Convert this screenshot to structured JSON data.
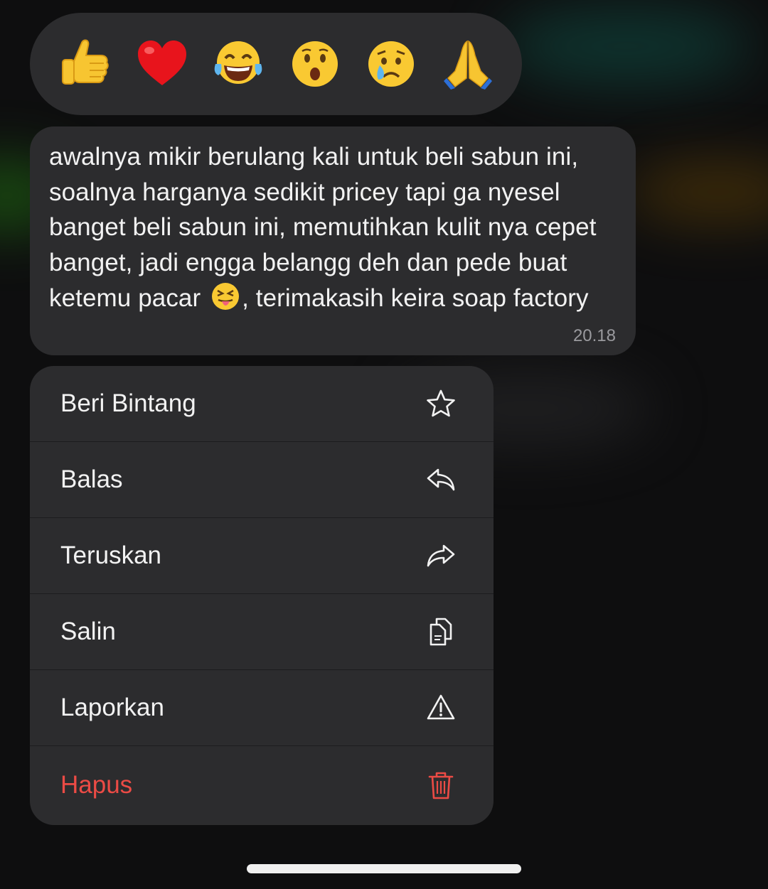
{
  "reactions": [
    {
      "icon": "thumbs-up-emoji",
      "glyph": "👍"
    },
    {
      "icon": "red-heart-emoji",
      "glyph": "❤️"
    },
    {
      "icon": "tears-of-joy-emoji",
      "glyph": "😂"
    },
    {
      "icon": "surprised-face-emoji",
      "glyph": "😮"
    },
    {
      "icon": "crying-face-emoji",
      "glyph": "😢"
    },
    {
      "icon": "folded-hands-emoji",
      "glyph": "🙏"
    }
  ],
  "message": {
    "text_before_emoji": "awalnya mikir berulang kali untuk beli sabun ini, soalnya harganya sedikit pricey tapi ga nyesel banget beli sabun ini, memutihkan kulit nya cepet banget, jadi engga belangg deh dan pede buat ketemu pacar",
    "inline_emoji": "😝",
    "inline_emoji_icon": "squinting-face-with-tongue-emoji",
    "text_after_emoji": ", terimakasih keira soap factory",
    "time": "20.18"
  },
  "menu": {
    "items": [
      {
        "label": "Beri Bintang",
        "icon": "star-icon"
      },
      {
        "label": "Balas",
        "icon": "reply-icon"
      },
      {
        "label": "Teruskan",
        "icon": "forward-icon"
      },
      {
        "label": "Salin",
        "icon": "copy-icon"
      },
      {
        "label": "Laporkan",
        "icon": "warning-icon"
      },
      {
        "label": "Hapus",
        "icon": "trash-icon"
      }
    ]
  },
  "colors": {
    "panel": "#2c2c2e",
    "background": "#0e0e0f",
    "text": "#f2f2f2",
    "danger": "#eb4b45",
    "timestamp": "#9a9a9e"
  }
}
